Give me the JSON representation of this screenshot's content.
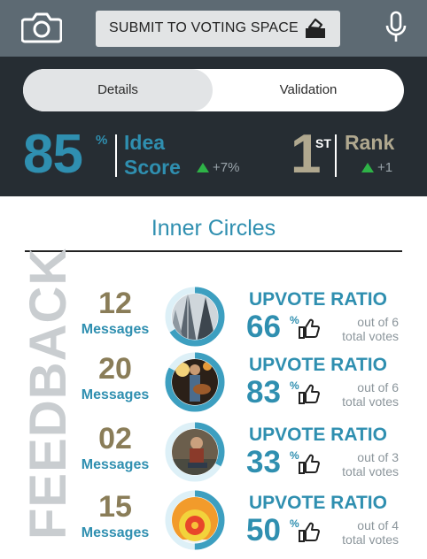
{
  "topbar": {
    "submit_label": "SUBMIT TO VOTING SPACE"
  },
  "icons": {
    "camera": "camera-icon",
    "submit": "ballot-box-icon",
    "mic": "microphone-icon",
    "thumbs_up": "thumbs-up-icon",
    "trend_up": "triangle-up-icon"
  },
  "tabs": [
    {
      "label": "Details",
      "active": false
    },
    {
      "label": "Validation",
      "active": true
    }
  ],
  "stats": {
    "score_value": "85",
    "score_unit": "%",
    "score_label_1": "Idea",
    "score_label_2": "Score",
    "score_change": "+7%",
    "rank_value": "1",
    "rank_suffix": "ST",
    "rank_label": "Rank",
    "rank_change": "+1"
  },
  "inner_circles": {
    "title": "Inner Circles",
    "side_label": "FEEDBACK",
    "rows": [
      {
        "messages": "12",
        "messages_label": "Messages",
        "upvote_title": "UPVOTE RATIO",
        "ratio": "66",
        "ratio_unit": "%",
        "out_of": "out of 6",
        "total_votes": "total votes",
        "ratio_fraction": 0.66,
        "avatar": "buildings-photo"
      },
      {
        "messages": "20",
        "messages_label": "Messages",
        "upvote_title": "UPVOTE RATIO",
        "ratio": "83",
        "ratio_unit": "%",
        "out_of": "out of 6",
        "total_votes": "total votes",
        "ratio_fraction": 0.83,
        "avatar": "guitarist-photo"
      },
      {
        "messages": "02",
        "messages_label": "Messages",
        "upvote_title": "UPVOTE RATIO",
        "ratio": "33",
        "ratio_unit": "%",
        "out_of": "out of 3",
        "total_votes": "total votes",
        "ratio_fraction": 0.33,
        "avatar": "seated-person-photo"
      },
      {
        "messages": "15",
        "messages_label": "Messages",
        "upvote_title": "UPVOTE RATIO",
        "ratio": "50",
        "ratio_unit": "%",
        "out_of": "out of 4",
        "total_votes": "total votes",
        "ratio_fraction": 0.5,
        "avatar": "layered-diagram-photo"
      }
    ]
  },
  "colors": {
    "accent_blue": "#2f8fb0",
    "accent_gold": "#b0a88f",
    "positive_green": "#2eb347",
    "dark_panel": "#262d33",
    "topbar": "#5d6a73"
  }
}
